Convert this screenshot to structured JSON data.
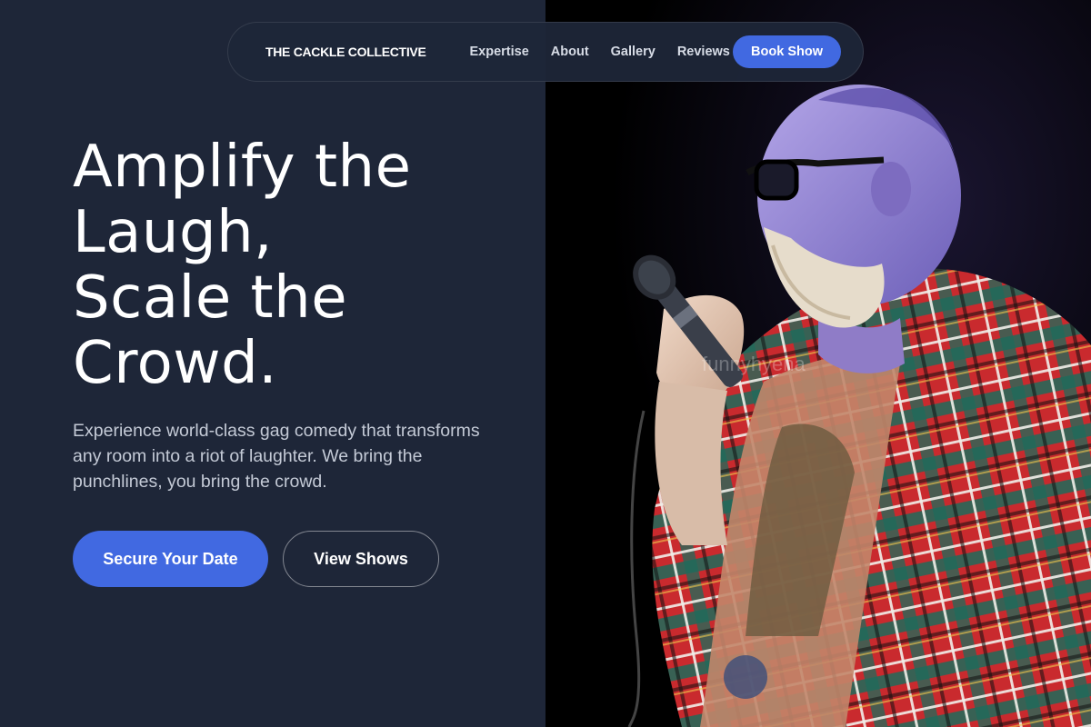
{
  "nav": {
    "brand": "THE CACKLE COLLECTIVE",
    "links": [
      "Expertise",
      "About",
      "Gallery",
      "Reviews"
    ],
    "cta": "Book Show"
  },
  "hero": {
    "title_lines": [
      "Amplify the",
      "Laugh,",
      "Scale the",
      "Crowd."
    ],
    "subtitle": "Experience world-class gag comedy that transforms any room into a riot of laughter. We bring the punchlines, you bring the crowd.",
    "primary_cta": "Secure Your Date",
    "secondary_cta": "View Shows"
  },
  "photo": {
    "watermark": "funnyhyena"
  },
  "colors": {
    "background": "#1e2638",
    "accent": "#4169e1",
    "text_primary": "#ffffff",
    "text_secondary": "#c4cad6"
  }
}
